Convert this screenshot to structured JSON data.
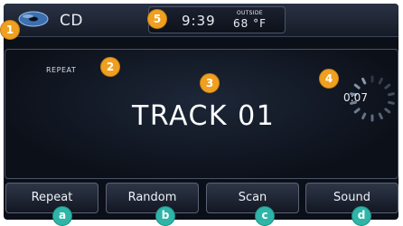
{
  "topbar": {
    "source_icon": "disc-icon",
    "source_label": "CD",
    "clock": "9:39",
    "outside_label": "OUTSIDE",
    "outside_temp": "68 °F"
  },
  "main": {
    "repeat_status": "REPEAT",
    "track_label": "TRACK 01",
    "elapsed_time": "0:07",
    "progress_icon": "progress-ring-icon"
  },
  "softkeys": [
    {
      "label": "Repeat"
    },
    {
      "label": "Random"
    },
    {
      "label": "Scan"
    },
    {
      "label": "Sound"
    }
  ],
  "callouts": {
    "numbers": [
      "1",
      "2",
      "3",
      "4",
      "5"
    ],
    "letters": [
      "a",
      "b",
      "c",
      "d"
    ]
  },
  "colors": {
    "callout_number": "#f0a020",
    "callout_letter": "#2fb5a8",
    "screen_background": "#0b0f18",
    "text": "#e8ecf2"
  }
}
